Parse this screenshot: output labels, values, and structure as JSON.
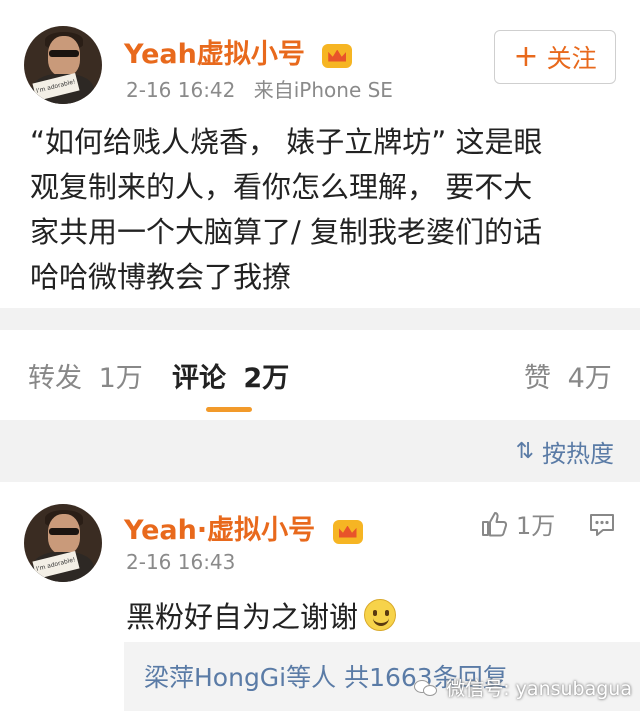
{
  "post": {
    "username": "Yeah虚拟小号",
    "time": "2-16 16:42",
    "source": "来自iPhone SE",
    "follow_label": "关注",
    "follow_plus": "+",
    "content_lines": [
      "“如何给贱人烧香， 婊子立牌坊” 这是眼",
      "观复制来的人，看你怎么理解，  要不大",
      "家共用一个大脑算了/  复制我老婆们的话",
      "哈哈微博教会了我撩"
    ],
    "avatar_sign_text": "I'm adorable!"
  },
  "tabs": {
    "repost_label": "转发",
    "repost_count": "1万",
    "comment_label": "评论",
    "comment_count": "2万",
    "like_label": "赞",
    "like_count": "4万"
  },
  "sort": {
    "icon": "sort-icon",
    "label": "按热度"
  },
  "comment": {
    "username": "Yeah·虚拟小号",
    "time": "2-16 16:43",
    "like_count": "1万",
    "text": "黑粉好自为之谢谢",
    "emoji": "smiley-emoji",
    "replies_text": "梁萍HongGi等人  共1663条回复"
  },
  "watermark": {
    "text": "微信号: yansubagua"
  },
  "colors": {
    "accent": "#e8691c",
    "link": "#5a7ba6",
    "muted": "#8a8a8a",
    "tab_underline": "#f29a2a",
    "band": "#f2f2f2"
  }
}
